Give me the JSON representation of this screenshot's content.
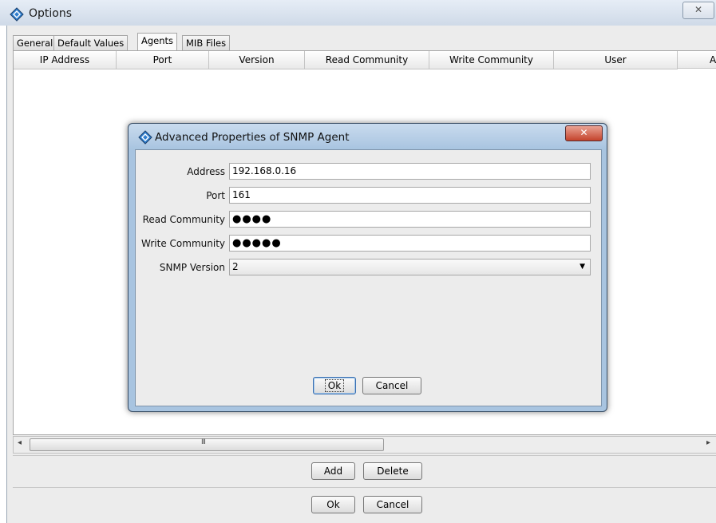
{
  "window": {
    "title": "Options",
    "close_glyph": "✕"
  },
  "tabs": [
    {
      "label": "General"
    },
    {
      "label": "Default Values"
    },
    {
      "label": "Agents",
      "active": true
    },
    {
      "label": "MIB Files"
    }
  ],
  "table": {
    "columns": [
      "IP Address",
      "Port",
      "Version",
      "Read Community",
      "Write Community",
      "User",
      "A"
    ],
    "rows": []
  },
  "scrollbar": {
    "left_arrow": "◂",
    "right_arrow": "▸",
    "grip": "III"
  },
  "agent_buttons": {
    "add_label": "Add",
    "delete_label": "Delete"
  },
  "footer_buttons": {
    "ok_label": "Ok",
    "cancel_label": "Cancel"
  },
  "dialog": {
    "title": "Advanced Properties of SNMP Agent",
    "close_glyph": "✕",
    "fields": [
      {
        "label": "Address",
        "value": "192.168.0.16"
      },
      {
        "label": "Port",
        "value": "161"
      },
      {
        "label": "Read Community",
        "value": "●●●●"
      },
      {
        "label": "Write Community",
        "value": "●●●●●"
      },
      {
        "label": "SNMP Version",
        "value": "2",
        "type": "select"
      }
    ],
    "select_arrow": "▼",
    "ok_label": "Ok",
    "cancel_label": "Cancel"
  },
  "icons": {
    "app_icon": "diamond-icon",
    "dialog_icon": "diamond-icon"
  }
}
